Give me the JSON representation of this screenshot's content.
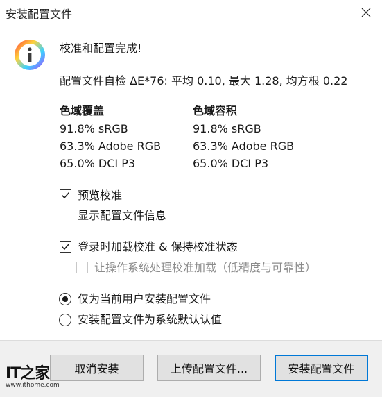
{
  "window": {
    "title": "安装配置文件"
  },
  "heading": "校准和配置完成!",
  "self_check": "配置文件自检 ΔE*76: 平均 0.10, 最大 1.28, 均方根 0.22",
  "gamut": {
    "coverage": {
      "title": "色域覆盖",
      "rows": [
        "91.8% sRGB",
        "63.3% Adobe RGB",
        "65.0% DCI P3"
      ]
    },
    "volume": {
      "title": "色域容积",
      "rows": [
        "91.8% sRGB",
        "63.3% Adobe RGB",
        "65.0% DCI P3"
      ]
    }
  },
  "options": {
    "preview": {
      "label": "预览校准",
      "checked": true
    },
    "show_info": {
      "label": "显示配置文件信息",
      "checked": false
    },
    "load_on_login": {
      "label": "登录时加载校准 & 保持校准状态",
      "checked": true
    },
    "os_loading": {
      "label": "让操作系统处理校准加载（低精度与可靠性）",
      "checked": false,
      "enabled": false
    }
  },
  "install_scope": {
    "current_user": {
      "label": "仅为当前用户安装配置文件",
      "selected": true
    },
    "system_default": {
      "label": "安装配置文件为系统默认认值",
      "selected": false
    }
  },
  "buttons": {
    "cancel": "取消安装",
    "upload": "上传配置文件...",
    "install": "安装配置文件"
  },
  "watermark": {
    "mark": "IT之家",
    "url": "www.ithome.com"
  },
  "colors": {
    "accent": "#0078d7",
    "footer_bg": "#f0f0f0",
    "button_bg": "#e1e1e1"
  }
}
